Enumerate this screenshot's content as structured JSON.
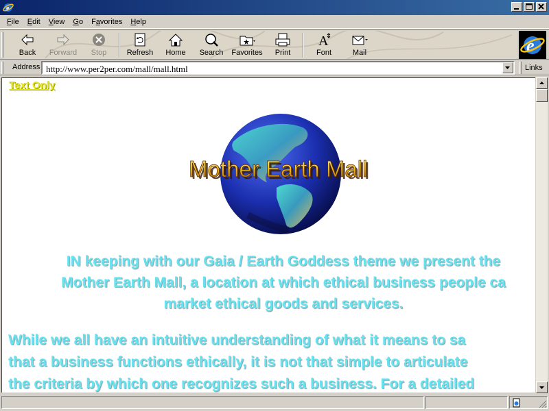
{
  "window": {
    "title": "",
    "app_icon": "ie-icon",
    "controls": [
      "minimize-icon",
      "maximize-icon",
      "close-icon"
    ]
  },
  "menu": {
    "items": [
      {
        "label": "File",
        "accel": "F"
      },
      {
        "label": "Edit",
        "accel": "E"
      },
      {
        "label": "View",
        "accel": "V"
      },
      {
        "label": "Go",
        "accel": "G"
      },
      {
        "label": "Favorites",
        "accel": "a"
      },
      {
        "label": "Help",
        "accel": "H"
      }
    ]
  },
  "toolbar": {
    "buttons": [
      {
        "label": "Back",
        "icon": "back-arrow-icon",
        "enabled": true
      },
      {
        "label": "Forward",
        "icon": "forward-arrow-icon",
        "enabled": false
      },
      {
        "label": "Stop",
        "icon": "stop-icon",
        "enabled": false
      },
      {
        "label": "Refresh",
        "icon": "refresh-icon",
        "enabled": true
      },
      {
        "label": "Home",
        "icon": "home-icon",
        "enabled": true
      },
      {
        "label": "Search",
        "icon": "search-icon",
        "enabled": true
      },
      {
        "label": "Favorites",
        "icon": "favorites-folder-icon",
        "enabled": true
      },
      {
        "label": "Print",
        "icon": "printer-icon",
        "enabled": true
      },
      {
        "label": "Font",
        "icon": "font-icon",
        "enabled": true
      },
      {
        "label": "Mail",
        "icon": "mail-icon",
        "enabled": true
      }
    ]
  },
  "address": {
    "label": "Address",
    "url": "http://www.per2per.com/mall/mall.html",
    "links_label": "Links"
  },
  "page": {
    "text_only_link": "Text Only",
    "logo_text": "Mother Earth Mall",
    "intro_lines": [
      "IN keeping with our Gaia / Earth Goddess theme we present the",
      "Mother Earth Mall, a location at which ethical business people ca",
      "market ethical goods and services."
    ],
    "body_lines": [
      "While we all have an intuitive understanding of what it means to sa",
      "that a business functions ethically, it is not that simple to articulate",
      "the criteria by which one recognizes such a business. For a detailed"
    ]
  },
  "colors": {
    "title_bar": "#0a246a",
    "link": "#e6e62a",
    "body_text": "#66e3f0",
    "chrome": "#d4d0c8"
  }
}
